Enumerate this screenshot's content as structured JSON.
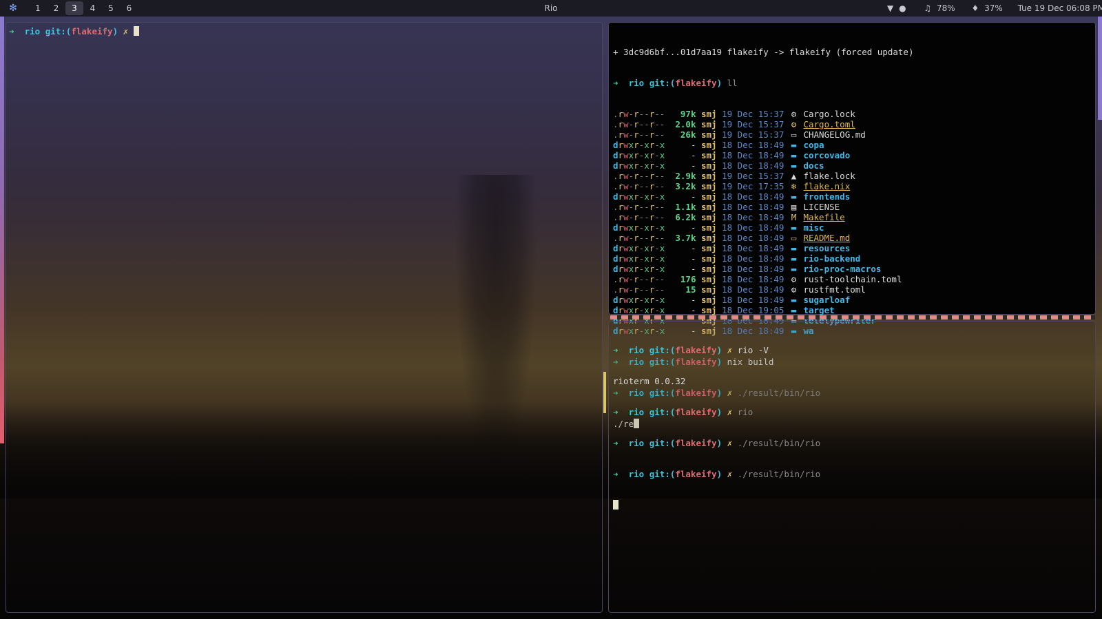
{
  "topbar": {
    "title": "Rio",
    "workspaces": [
      "1",
      "2",
      "3",
      "4",
      "5",
      "6"
    ],
    "active_workspace": "3",
    "volume": "78%",
    "mic": "37%",
    "datetime": "Tue 19 Dec 06:08 PM"
  },
  "left_pane": {
    "prompt_arrow": "➜",
    "dir": "rio",
    "git_label": "git:(",
    "branch": "flakeify",
    "git_close": ")",
    "dirty": "✗"
  },
  "right_top": {
    "header": "+ 3dc9d6bf...01d7aa19 flakeify -> flakeify (forced update)",
    "cmd_ll": "ll",
    "listing": [
      {
        "perm": ".rw-r--r--",
        "size": "97k",
        "user": "smj",
        "date": "19 Dec 15:37",
        "icon": "rust-icon",
        "glyph": "⚙",
        "name": "Cargo.lock",
        "kind": "file"
      },
      {
        "perm": ".rw-r--r--",
        "size": "2.0k",
        "user": "smj",
        "date": "19 Dec 15:37",
        "icon": "rust-icon",
        "glyph": "⚙",
        "name": "Cargo.toml",
        "kind": "link"
      },
      {
        "perm": ".rw-r--r--",
        "size": "26k",
        "user": "smj",
        "date": "19 Dec 15:37",
        "icon": "markdown-icon",
        "glyph": "▭",
        "name": "CHANGELOG.md",
        "kind": "file"
      },
      {
        "perm": "drwxr-xr-x",
        "size": "-",
        "user": "smj",
        "date": "18 Dec 18:49",
        "icon": "folder-icon",
        "glyph": "▬",
        "name": "copa",
        "kind": "dir"
      },
      {
        "perm": "drwxr-xr-x",
        "size": "-",
        "user": "smj",
        "date": "18 Dec 18:49",
        "icon": "folder-icon",
        "glyph": "▬",
        "name": "corcovado",
        "kind": "dir"
      },
      {
        "perm": "drwxr-xr-x",
        "size": "-",
        "user": "smj",
        "date": "18 Dec 18:49",
        "icon": "folder-icon",
        "glyph": "▬",
        "name": "docs",
        "kind": "dir"
      },
      {
        "perm": ".rw-r--r--",
        "size": "2.9k",
        "user": "smj",
        "date": "19 Dec 15:37",
        "icon": "lock-icon",
        "glyph": "▲",
        "name": "flake.lock",
        "kind": "file"
      },
      {
        "perm": ".rw-r--r--",
        "size": "3.2k",
        "user": "smj",
        "date": "19 Dec 17:35",
        "icon": "nix-icon",
        "glyph": "❄",
        "name": "flake.nix",
        "kind": "link"
      },
      {
        "perm": "drwxr-xr-x",
        "size": "-",
        "user": "smj",
        "date": "18 Dec 18:49",
        "icon": "folder-icon",
        "glyph": "▬",
        "name": "frontends",
        "kind": "dir"
      },
      {
        "perm": ".rw-r--r--",
        "size": "1.1k",
        "user": "smj",
        "date": "18 Dec 18:49",
        "icon": "license-icon",
        "glyph": "▤",
        "name": "LICENSE",
        "kind": "file"
      },
      {
        "perm": ".rw-r--r--",
        "size": "6.2k",
        "user": "smj",
        "date": "18 Dec 18:49",
        "icon": "makefile-icon",
        "glyph": "M",
        "name": "Makefile",
        "kind": "link"
      },
      {
        "perm": "drwxr-xr-x",
        "size": "-",
        "user": "smj",
        "date": "18 Dec 18:49",
        "icon": "folder-icon",
        "glyph": "▬",
        "name": "misc",
        "kind": "dir"
      },
      {
        "perm": ".rw-r--r--",
        "size": "3.7k",
        "user": "smj",
        "date": "18 Dec 18:49",
        "icon": "markdown-icon",
        "glyph": "▭",
        "name": "README.md",
        "kind": "link"
      },
      {
        "perm": "drwxr-xr-x",
        "size": "-",
        "user": "smj",
        "date": "18 Dec 18:49",
        "icon": "folder-icon",
        "glyph": "▬",
        "name": "resources",
        "kind": "dir"
      },
      {
        "perm": "drwxr-xr-x",
        "size": "-",
        "user": "smj",
        "date": "18 Dec 18:49",
        "icon": "folder-icon",
        "glyph": "▬",
        "name": "rio-backend",
        "kind": "dir"
      },
      {
        "perm": "drwxr-xr-x",
        "size": "-",
        "user": "smj",
        "date": "18 Dec 18:49",
        "icon": "folder-icon",
        "glyph": "▬",
        "name": "rio-proc-macros",
        "kind": "dir"
      },
      {
        "perm": ".rw-r--r--",
        "size": "176",
        "user": "smj",
        "date": "18 Dec 18:49",
        "icon": "gear-icon",
        "glyph": "⚙",
        "name": "rust-toolchain.toml",
        "kind": "file"
      },
      {
        "perm": ".rw-r--r--",
        "size": "15",
        "user": "smj",
        "date": "18 Dec 18:49",
        "icon": "gear-icon",
        "glyph": "⚙",
        "name": "rustfmt.toml",
        "kind": "file"
      },
      {
        "perm": "drwxr-xr-x",
        "size": "-",
        "user": "smj",
        "date": "18 Dec 18:49",
        "icon": "folder-icon",
        "glyph": "▬",
        "name": "sugarloaf",
        "kind": "dir"
      },
      {
        "perm": "drwxr-xr-x",
        "size": "-",
        "user": "smj",
        "date": "18 Dec 19:05",
        "icon": "folder-icon",
        "glyph": "▬",
        "name": "target",
        "kind": "dir"
      },
      {
        "perm": "drwxr-xr-x",
        "size": "-",
        "user": "smj",
        "date": "18 Dec 18:49",
        "icon": "folder-icon",
        "glyph": "▬",
        "name": "teletypewriter",
        "kind": "dir"
      },
      {
        "perm": "drwxr-xr-x",
        "size": "-",
        "user": "smj",
        "date": "18 Dec 18:49",
        "icon": "folder-icon",
        "glyph": "▬",
        "name": "wa",
        "kind": "dir"
      }
    ],
    "cmd_nix": "nix build",
    "cmd_run": "./result/bin/rio",
    "input_line": "./re"
  },
  "right_bottom": {
    "cmd_version": "rio -V",
    "version_output": "rioterm 0.0.32",
    "cmd_rio": "rio",
    "cmd_run1": "./result/bin/rio",
    "cmd_run2": "./result/bin/rio"
  },
  "colors": {
    "prompt_arrow": "#46c89a",
    "dir": "#3ec3dc",
    "branch": "#e06c75",
    "divider": "#e08a8a"
  }
}
